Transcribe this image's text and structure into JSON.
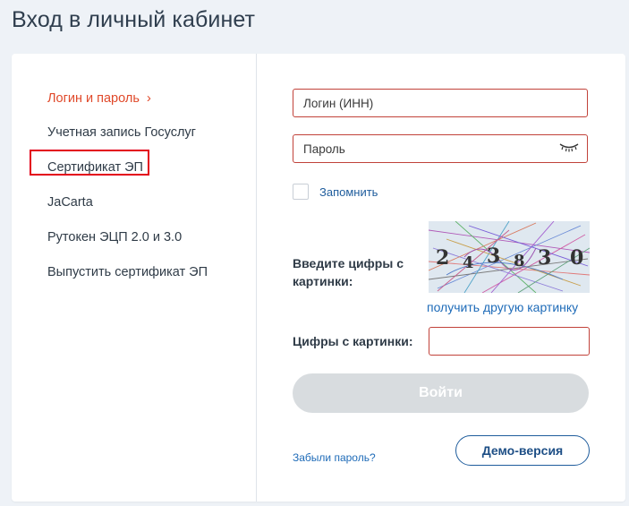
{
  "page": {
    "title": "Вход в личный кабинет"
  },
  "sidebar": {
    "items": [
      {
        "label": "Логин и пароль",
        "active": true
      },
      {
        "label": "Учетная запись Госуслуг",
        "active": false
      },
      {
        "label": "Сертификат ЭП",
        "active": false,
        "highlighted": true
      },
      {
        "label": "JaCarta",
        "active": false
      },
      {
        "label": "Рутокен ЭЦП 2.0 и 3.0",
        "active": false
      },
      {
        "label": "Выпустить сертификат ЭП",
        "active": false
      }
    ],
    "active_chevron": "›"
  },
  "form": {
    "login_placeholder": "Логин (ИНН)",
    "password_placeholder": "Пароль",
    "password_toggle_icon": "closed-eye-icon",
    "remember_label": "Запомнить",
    "captcha_prompt": "Введите цифры с картинки:",
    "captcha_digits": [
      "2",
      "4",
      "3",
      "8",
      "3",
      "0"
    ],
    "refresh_captcha_label": "получить другую картинку",
    "captcha_input_label": "Цифры с картинки:",
    "submit_label": "Войти",
    "forgot_label": "Забыли пароль?",
    "demo_label": "Демо-версия"
  },
  "colors": {
    "accent": "#e0492a",
    "link": "#1e6bb8",
    "field_border": "#c1423a",
    "highlight": "#e3001b",
    "disabled_button": "#d8dcdf"
  }
}
